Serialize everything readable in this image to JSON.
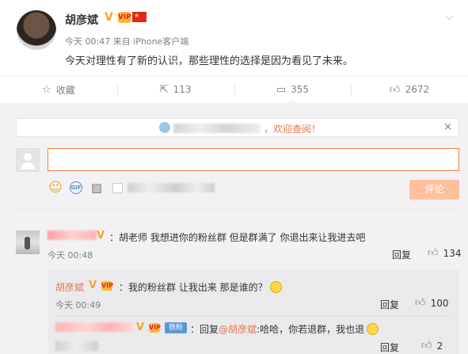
{
  "post": {
    "author": "胡彦斌",
    "badge_vip": "VIP",
    "meta": "今天 00:47 来自 iPhone客户端",
    "content": "今天对理性有了新的认识，那些理性的选择是因为看见了未来。",
    "collapse_icon": "chevron-down-icon"
  },
  "actions": [
    {
      "icon": "star-icon",
      "label": "收藏"
    },
    {
      "icon": "share-icon",
      "label": "113"
    },
    {
      "icon": "comment-icon",
      "label": "355"
    },
    {
      "icon": "thumbs-up-icon",
      "label": "2672"
    }
  ],
  "notice": {
    "text": "，欢迎查阅！",
    "close": "×"
  },
  "composer": {
    "placeholder": "",
    "submit_label": "评论"
  },
  "comments": [
    {
      "text": "：胡老师 我想进你的粉丝群 但是群满了 你退出来让我进去吧",
      "time": "今天 00:48",
      "reply_label": "回复",
      "likes": "134",
      "replies": [
        {
          "author": "胡彦斌",
          "text": "：我的粉丝群 让我出来 那是谁的？",
          "time": "今天 00:49",
          "reply_label": "回复",
          "likes": "100"
        },
        {
          "fan_badge": "铁粉",
          "prefix": "：回复",
          "mention": "@胡彦斌",
          "text": ":哈哈，你若退群，我也退",
          "reply_label": "回复",
          "likes": "2"
        }
      ]
    }
  ],
  "colors": {
    "accent": "#eb7350",
    "input_border": "#fa7d3c",
    "submit_bg": "#ffc09f",
    "comment_bg": "#f2f2f5"
  }
}
